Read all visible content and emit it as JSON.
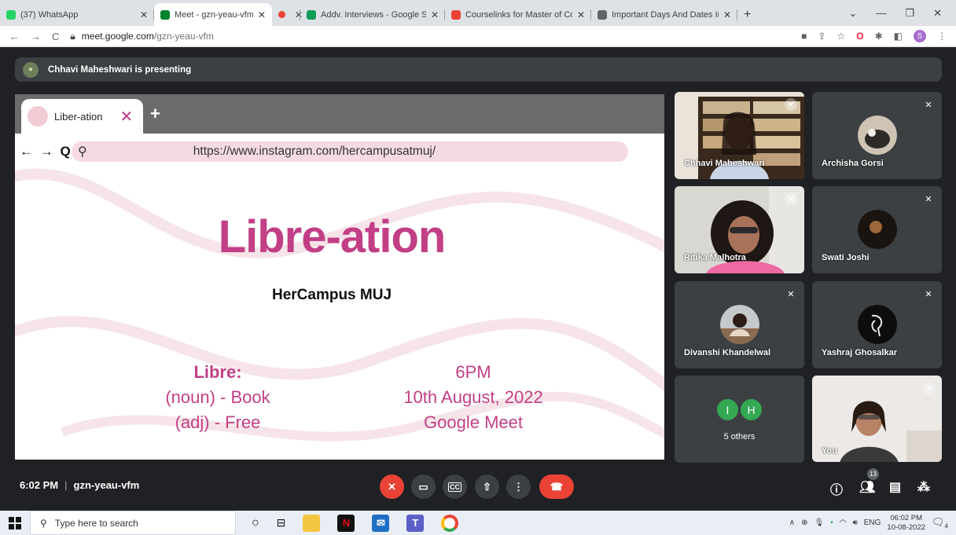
{
  "tabs": [
    {
      "title": "(37) WhatsApp",
      "color": "#25d366",
      "active": false,
      "width": 196
    },
    {
      "title": "Meet - gzn-yeau-vfm",
      "color": "#00832d",
      "active": true,
      "width": 150
    },
    {
      "title": "",
      "color": "#ea4335",
      "active": false,
      "width": 36
    },
    {
      "title": "Addv. Interviews - Google Sheets",
      "color": "#0f9d58",
      "active": false,
      "width": 184
    },
    {
      "title": "Courselinks for Master of Counse",
      "color": "#ea4335",
      "active": false,
      "width": 186
    },
    {
      "title": "Important Days And Dates In Sep",
      "color": "#5f6368",
      "active": false,
      "width": 186
    }
  ],
  "browser": {
    "url_domain": "meet.google.com",
    "url_path": "/gzn-yeau-vfm",
    "new_tab": "+",
    "profile_initial": "S"
  },
  "banner": {
    "text": "Chhavi Maheshwari is presenting"
  },
  "slide": {
    "tab_label": "Liber-ation",
    "nav": "← → Q",
    "url": "https://www.instagram.com/hercampusatmuj/",
    "title": "Libre-ation",
    "subtitle": "HerCampus MUJ",
    "def_head": "Libre:",
    "def_line1": "(noun) - Book",
    "def_line2": "(adj) - Free",
    "time": "6PM",
    "date": "10th August, 2022",
    "venue": "Google Meet"
  },
  "participants": [
    {
      "name": "Chhavi Maheshwari"
    },
    {
      "name": "Archisha Gorsi"
    },
    {
      "name": "Ritika Malhotra"
    },
    {
      "name": "Swati Joshi"
    },
    {
      "name": "Divanshi Khandelwal"
    },
    {
      "name": "Yashraj Ghosalkar"
    },
    {
      "name": "5 others",
      "initials": [
        "I",
        "H"
      ]
    },
    {
      "name": "You"
    }
  ],
  "meeting": {
    "time": "6:02 PM",
    "code": "gzn-yeau-vfm",
    "participant_count": "13"
  },
  "taskbar": {
    "search_placeholder": "Type here to search",
    "lang": "ENG",
    "clock_time": "06:02 PM",
    "clock_date": "10-08-2022",
    "notif_count": "4"
  }
}
